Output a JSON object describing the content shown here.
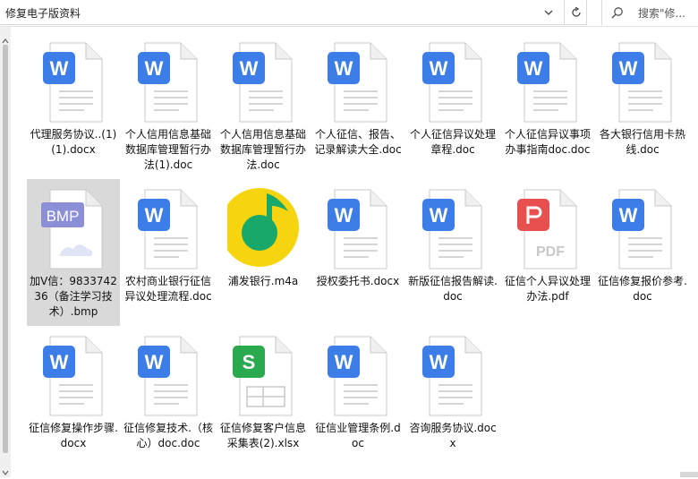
{
  "address": {
    "path": "修复电子版资料"
  },
  "search": {
    "placeholder": "搜索\"修..."
  },
  "files": [
    {
      "name": "代理服务协议..(1)(1).docx",
      "type": "word"
    },
    {
      "name": "个人信用信息基础数据库管理暂行办法(1).doc",
      "type": "word"
    },
    {
      "name": "个人信用信息基础数据库管理暂行办法.doc",
      "type": "word"
    },
    {
      "name": "个人征信、报告、记录解读大全.doc",
      "type": "word"
    },
    {
      "name": "个人征信异议处理章程.doc",
      "type": "word"
    },
    {
      "name": "个人征信异议事项办事指南doc.doc",
      "type": "word"
    },
    {
      "name": "各大银行信用卡热线.doc",
      "type": "word"
    },
    {
      "name": "加V信：983374236（备注学习技术）.bmp",
      "type": "bmp"
    },
    {
      "name": "农村商业银行征信异议处理流程.doc",
      "type": "word"
    },
    {
      "name": "浦发银行.m4a",
      "type": "music"
    },
    {
      "name": "授权委托书.docx",
      "type": "word"
    },
    {
      "name": "新版征信报告解读.doc",
      "type": "word"
    },
    {
      "name": "征信个人异议处理办法.pdf",
      "type": "pdf"
    },
    {
      "name": "征信修复报价参考.doc",
      "type": "word"
    },
    {
      "name": "征信修复操作步骤.docx",
      "type": "word"
    },
    {
      "name": "征信修复技术.（核心）doc.doc",
      "type": "word"
    },
    {
      "name": "征信修复客户信息采集表(2).xlsx",
      "type": "excel"
    },
    {
      "name": "征信业管理条例.doc",
      "type": "word"
    },
    {
      "name": "咨询服务协议.docx",
      "type": "word"
    }
  ],
  "selected_file": "加V信：983374236（备注学习技术）.bmp",
  "colors": {
    "word_blue": "#3d7de8",
    "pdf_red": "#e8504f",
    "excel_green": "#2aa94f",
    "bmp_purple": "#8a8fd8",
    "music_yellow": "#f6d40f",
    "music_green": "#17a86a"
  },
  "icons": {
    "word": "W",
    "pdf": "pdf-logo",
    "excel": "S",
    "bmp": "BMP",
    "music": "music-note"
  }
}
